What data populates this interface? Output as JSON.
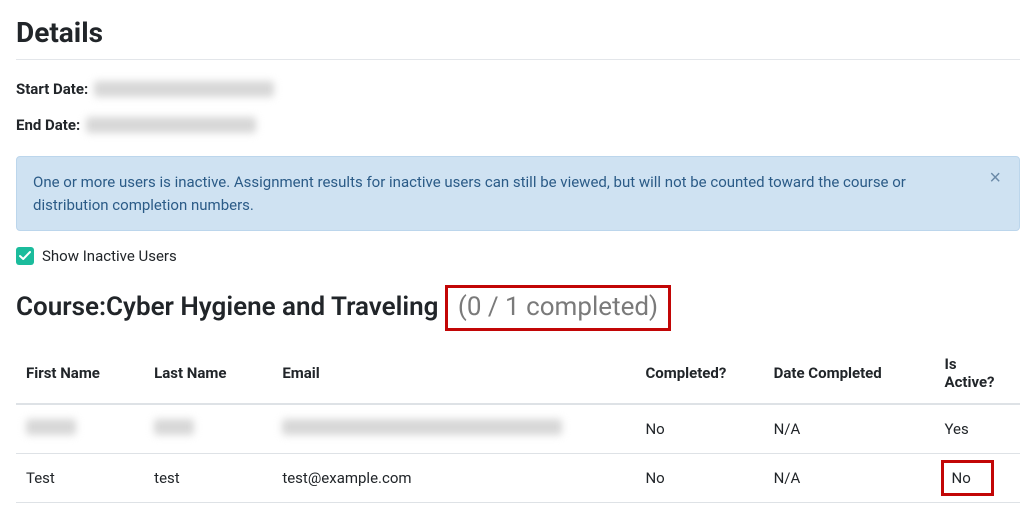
{
  "heading": "Details",
  "startDateLabel": "Start Date:",
  "endDateLabel": "End Date:",
  "alertText": "One or more users is inactive. Assignment results for inactive users can still be viewed, but will not be counted toward the course or distribution completion numbers.",
  "checkboxLabel": "Show Inactive Users",
  "courseLabelPrefix": "Course: ",
  "courseName": "Cyber Hygiene and Traveling",
  "completionText": "(0 / 1 completed)",
  "columns": {
    "firstName": "First Name",
    "lastName": "Last Name",
    "email": "Email",
    "completed": "Completed?",
    "dateCompleted": "Date Completed",
    "isActive": "Is Active?"
  },
  "rows": [
    {
      "firstName": "",
      "lastName": "",
      "email": "",
      "completed": "No",
      "dateCompleted": "N/A",
      "isActive": "Yes",
      "redacted": true
    },
    {
      "firstName": "Test",
      "lastName": "test",
      "email": "test@example.com",
      "completed": "No",
      "dateCompleted": "N/A",
      "isActive": "No",
      "redacted": false
    }
  ]
}
